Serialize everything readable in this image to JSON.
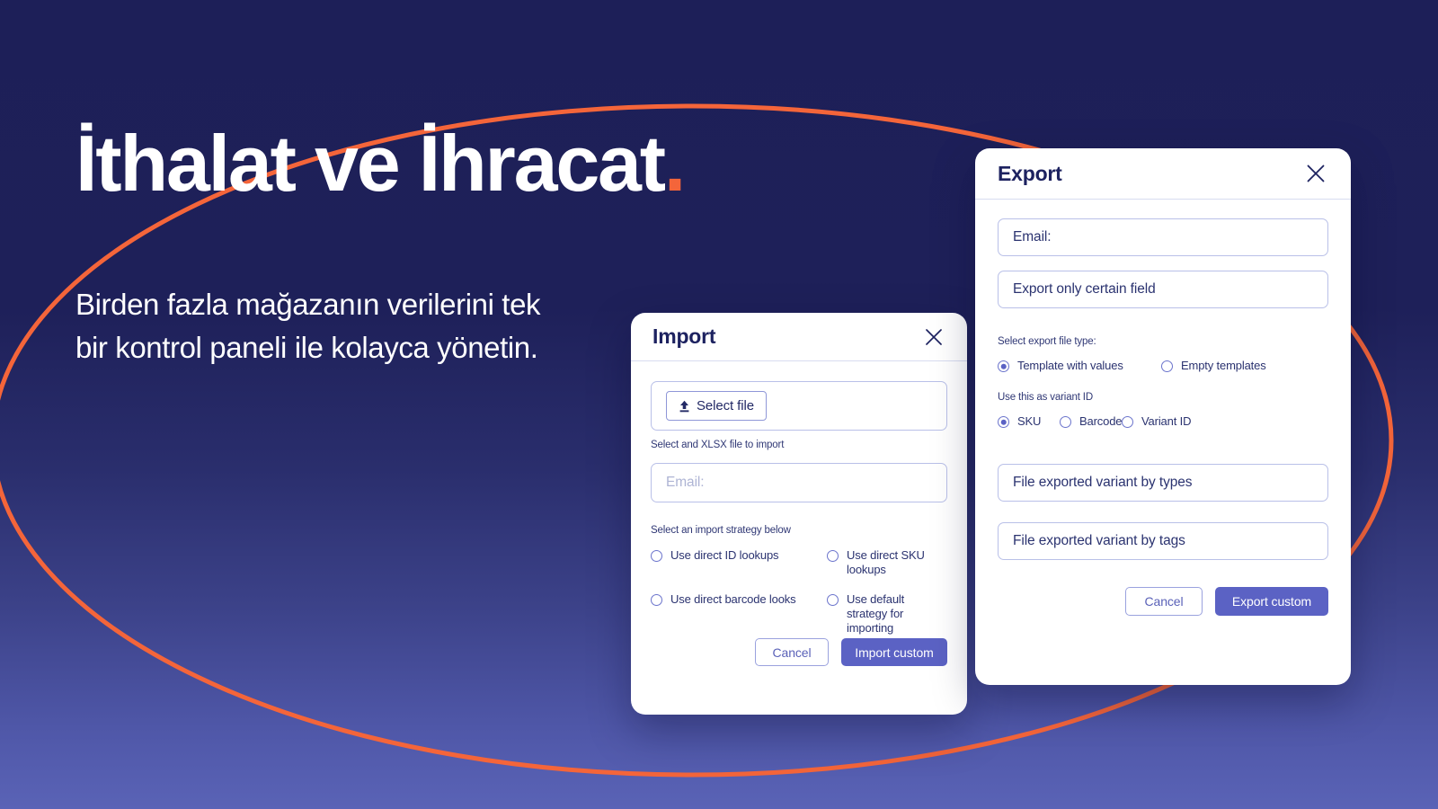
{
  "hero": {
    "title_main": "İthalat ve İhracat",
    "title_dot": ".",
    "subtitle": "Birden fazla mağazanın verilerini tek\nbir kontrol paneli ile kolayca yönetin."
  },
  "colors": {
    "background_top": "#1d1f58",
    "background_bottom": "#5a63b6",
    "accent_orange": "#f4653a",
    "primary_indigo": "#5b62c4",
    "navy_text": "#1d2260"
  },
  "import_dialog": {
    "title": "Import",
    "close_icon": "close-icon",
    "select_file_label": "Select file",
    "upload_icon": "upload-icon",
    "helper_text": "Select and XLSX file to import",
    "email_placeholder": "Email:",
    "email_value": "",
    "strategy_label": "Select an import strategy below",
    "strategies": [
      {
        "label": "Use direct ID lookups",
        "selected": false
      },
      {
        "label": "Use direct SKU lookups",
        "selected": false
      },
      {
        "label": "Use direct barcode looks",
        "selected": false
      },
      {
        "label": "Use default strategy for importing",
        "selected": false
      }
    ],
    "cancel_label": "Cancel",
    "submit_label": "Import custom"
  },
  "export_dialog": {
    "title": "Export",
    "close_icon": "close-icon",
    "email_label": "Email:",
    "certain_field_label": "Export only certain field",
    "file_type_label": "Select export file type:",
    "file_types": [
      {
        "label": "Template with values",
        "selected": true
      },
      {
        "label": "Empty templates",
        "selected": false
      }
    ],
    "variant_id_label": "Use this as variant ID",
    "variant_ids": [
      {
        "label": "SKU",
        "selected": true
      },
      {
        "label": "Barcode",
        "selected": false
      },
      {
        "label": "Variant ID",
        "selected": false
      }
    ],
    "variant_by_types_label": "File exported variant by types",
    "variant_by_tags_label": "File exported variant by tags",
    "cancel_label": "Cancel",
    "submit_label": "Export custom"
  }
}
